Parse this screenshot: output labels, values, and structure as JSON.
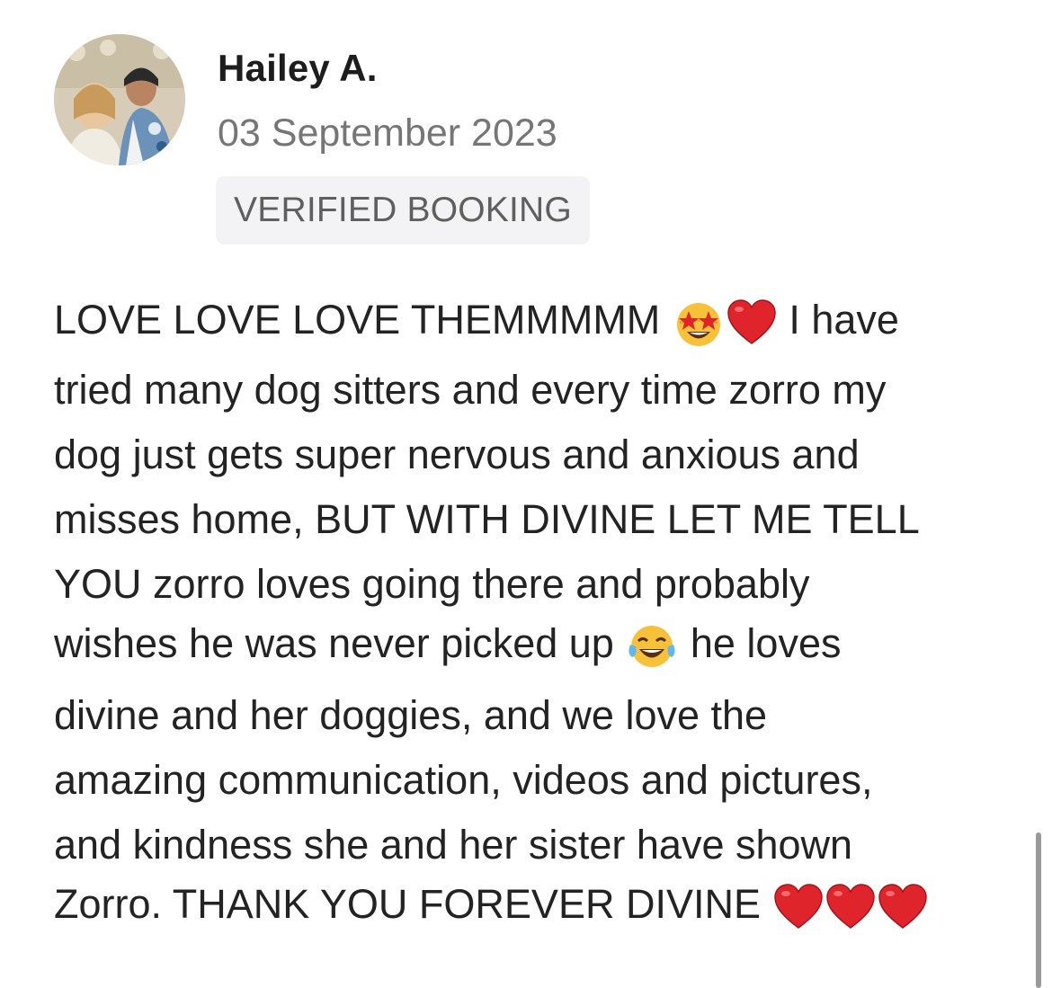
{
  "review": {
    "reviewer_name": "Hailey A.",
    "date": "03 September 2023",
    "badge": "VERIFIED BOOKING",
    "lines": [
      {
        "before": "LOVE LOVE LOVE THEMMMMM",
        "emojis": [
          "star-struck-emoji",
          "red-heart-emoji"
        ],
        "after": "I have"
      },
      {
        "text": "tried many dog sitters and every time zorro my"
      },
      {
        "text": "dog just gets super nervous and anxious and"
      },
      {
        "text": "misses home, BUT WITH DIVINE LET ME TELL"
      },
      {
        "text": "YOU zorro loves going there and probably"
      },
      {
        "before": "wishes he was never picked up",
        "emojis": [
          "tears-of-joy-emoji"
        ],
        "after": "he loves"
      },
      {
        "text": "divine and her doggies, and we love the"
      },
      {
        "text": "amazing communication, videos and pictures,"
      },
      {
        "text": "and kindness she and her sister have shown"
      },
      {
        "before": "Zorro. THANK YOU FOREVER DIVINE",
        "emojis": [
          "red-heart-emoji",
          "red-heart-emoji",
          "red-heart-emoji"
        ],
        "after": ""
      }
    ]
  },
  "colors": {
    "heart": "#e0242c",
    "emoji_yellow": "#f7c23a",
    "badge_bg": "#f3f3f5",
    "date_text": "#767676"
  }
}
